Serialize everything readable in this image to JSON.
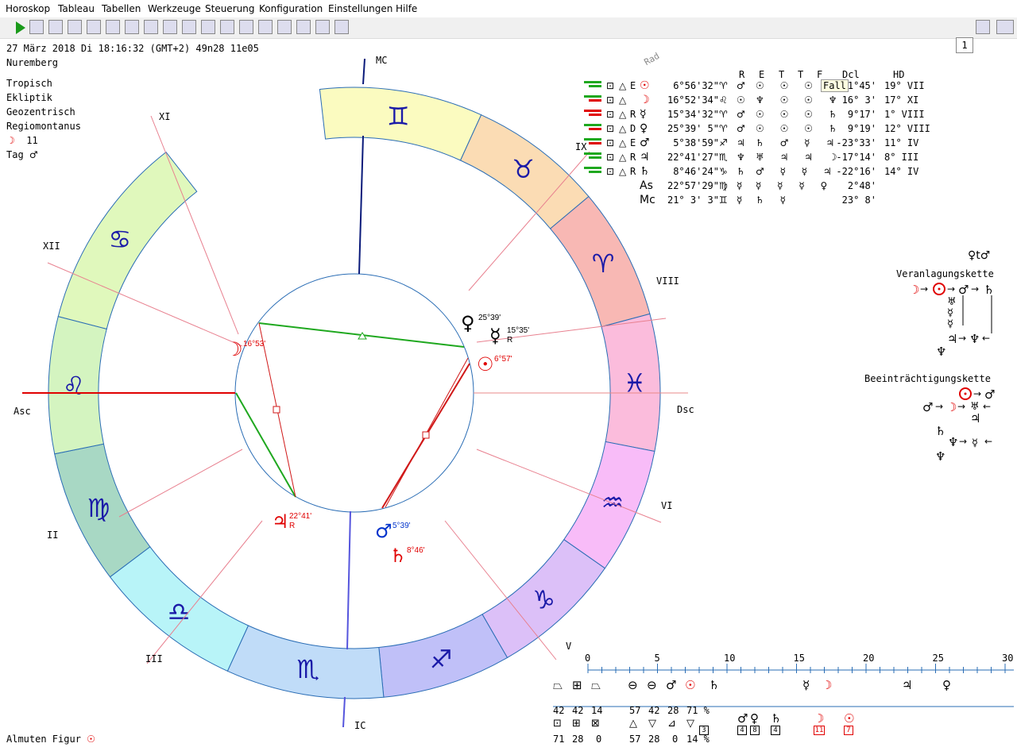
{
  "menu": [
    "Horoskop",
    "Tableau",
    "Tabellen",
    "Werkzeuge",
    "Steuerung",
    "Konfiguration",
    "Einstellungen",
    "Hilfe"
  ],
  "toolbar": {
    "spin_value": "1"
  },
  "chart_info": {
    "date_line": "27 März 2018  Di  18:16:32 (GMT+2) 49n28  11e05",
    "place": "Nuremberg",
    "lines": [
      "Tropisch",
      "Ekliptik",
      "Geozentrisch",
      "Regiomontanus"
    ],
    "moon_label": "11",
    "tag_label": "Tag",
    "almuten_label": "Almuten Figur"
  },
  "wheel": {
    "axis_labels": {
      "mc": "MC",
      "ic": "IC",
      "asc": "Asc",
      "dsc": "Dsc"
    },
    "house_labels": [
      "XI",
      "XII",
      "II",
      "III",
      "V",
      "VI",
      "VIII",
      "IX"
    ],
    "planets": [
      {
        "glyph": "☽",
        "deg": "16°53'",
        "color": "#e00000"
      },
      {
        "glyph": "♀",
        "deg": "25°39'",
        "color": "#000000"
      },
      {
        "glyph": "☿",
        "deg": "15°35'",
        "retro": "R",
        "color": "#000000"
      },
      {
        "glyph": "☉",
        "deg": "6°57'",
        "color": "#e00000"
      },
      {
        "glyph": "♃",
        "deg": "22°41'",
        "retro": "R",
        "color": "#e00000"
      },
      {
        "glyph": "♂",
        "deg": "5°39'",
        "color": "#0033cc"
      },
      {
        "glyph": "♄",
        "deg": "8°46'",
        "color": "#e00000"
      }
    ],
    "signs": [
      {
        "glyph": "♊",
        "color": "#fbfbc0"
      },
      {
        "glyph": "♉",
        "color": "#fbdcb4"
      },
      {
        "glyph": "♈",
        "color": "#f8b8b4"
      },
      {
        "glyph": "♓",
        "color": "#fbbcdc"
      },
      {
        "glyph": "♒",
        "color": "#f8bcf8"
      },
      {
        "glyph": "♑",
        "color": "#dcc0f8"
      },
      {
        "glyph": "♐",
        "color": "#c0c0f8"
      },
      {
        "glyph": "♏",
        "color": "#c0dcf8"
      },
      {
        "glyph": "♎",
        "color": "#b8f4f8"
      },
      {
        "glyph": "♍",
        "color": "#a8d8c4"
      },
      {
        "glyph": "♌",
        "color": "#d4f4c0"
      },
      {
        "glyph": "♋",
        "color": "#e0f8bc"
      }
    ]
  },
  "table": {
    "rad_label": "Rad",
    "headers": [
      "R",
      "E",
      "T",
      "T",
      "F",
      "Dcl",
      "HD"
    ],
    "rows": [
      {
        "flag": "E",
        "glyph": "☉",
        "pos": "6°56'32\"",
        "sign": "♈",
        "rul": "♂",
        "dig": "☉ ☉ ☉ ♄",
        "dcl": "1°45'",
        "hd": "19° VII"
      },
      {
        "flag": "",
        "glyph": "☽",
        "pos": "16°52'34\"",
        "sign": "♌",
        "rul": "☉",
        "dig": "♆ ☉ ☉ ♆",
        "dcl": "16° 3'",
        "hd": "17° XI"
      },
      {
        "flag": "R",
        "glyph": "☿",
        "pos": "15°34'32\"",
        "sign": "♈",
        "rul": "♂",
        "dig": "☉ ☉ ☉ ♄",
        "dcl": "9°17'",
        "hd": "1° VIII"
      },
      {
        "flag": "D",
        "glyph": "♀",
        "pos": "25°39' 5\"",
        "sign": "♈",
        "rul": "♂",
        "dig": "☉ ☉ ☉ ♄",
        "dcl": "9°19'",
        "hd": "12° VIII"
      },
      {
        "flag": "E",
        "glyph": "♂",
        "pos": "5°38'59\"",
        "sign": "♐",
        "rul": "♃",
        "dig": "♄ ♂ ☿ ♃",
        "dcl": "-23°33'",
        "hd": "11° IV"
      },
      {
        "flag": "R",
        "glyph": "♃",
        "pos": "22°41'27\"",
        "sign": "♏",
        "rul": "♆",
        "dig": "♅ ♃ ♃ ☽",
        "dcl": "-17°14'",
        "hd": "8° III"
      },
      {
        "flag": "R",
        "glyph": "♄",
        "pos": "8°46'24\"",
        "sign": "♑",
        "rul": "♄",
        "dig": "♂ ☿ ☿ ♃",
        "dcl": "-22°16'",
        "hd": "14° IV"
      },
      {
        "flag": "",
        "glyph": "As",
        "pos": "22°57'29\"",
        "sign": "♍",
        "rul": "☿",
        "dig": "☿ ☿ ☿ ♀",
        "dcl": "2°48'",
        "hd": ""
      },
      {
        "flag": "",
        "glyph": "Mc",
        "pos": "21° 3' 3\"",
        "sign": "♊",
        "rul": "☿",
        "dig": "  ♄ ☿",
        "dcl": "23° 8'",
        "hd": ""
      }
    ],
    "tooltip": "Fall"
  },
  "chains": {
    "top_symbols": "♀t♂",
    "veranlagung_title": "Veranlagungskette",
    "beeintr_title": "Beeinträchtigungskette"
  },
  "bottom": {
    "ticks": [
      "0",
      "5",
      "10",
      "15",
      "20",
      "25",
      "30"
    ],
    "row1_vals": [
      "42",
      "42",
      "14",
      "57",
      "42",
      "28",
      "71 %"
    ],
    "row2_vals": [
      "71",
      "28",
      "0",
      "57",
      "28",
      "0",
      "14 %"
    ],
    "box_vals": [
      "4",
      "8",
      "4",
      "11",
      "7",
      "3"
    ]
  }
}
